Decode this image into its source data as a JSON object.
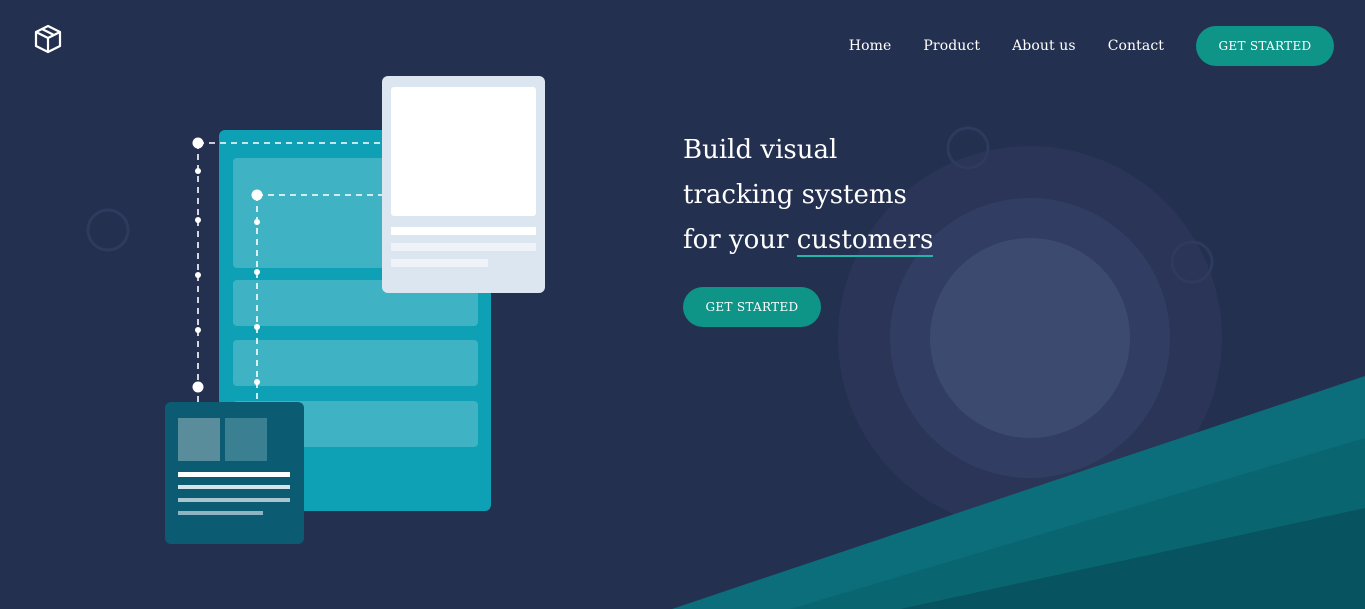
{
  "header": {
    "logo": "box-icon",
    "nav": {
      "home": "Home",
      "product": "Product",
      "about": "About us",
      "contact": "Contact"
    },
    "cta_label": "GET STARTED"
  },
  "hero": {
    "line1": "Build visual",
    "line2": "tracking systems",
    "line3_prefix": "for your ",
    "line3_highlight": "customers",
    "cta_label": "GET STARTED"
  },
  "colors": {
    "background": "#24304f",
    "accent": "#0f9488",
    "underline": "#22b5a8",
    "panel": "#0ea0b5",
    "dark_card": "#0b5c73",
    "light_card": "#dbe6f0"
  }
}
